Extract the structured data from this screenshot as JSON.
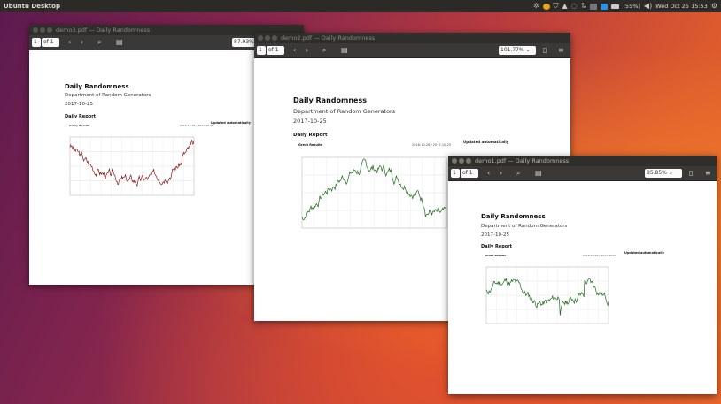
{
  "panel": {
    "title": "Ubuntu Desktop",
    "battery": "(55%)",
    "datetime": "Wed Oct 25 15:53"
  },
  "windows": [
    {
      "title": "demo3.pdf — Daily Randomness",
      "page_number": "1",
      "page_of": "of 1",
      "zoom": "87.93%",
      "doc": {
        "title": "Daily Randomness",
        "department": "Department of Random Generators",
        "date": "2017-10-25",
        "section": "Daily Report",
        "updated": "Updated automatically",
        "chart_name": "Grimy Results",
        "chart_range": "2016-10-26 / 2017-10-25",
        "line_color": "#8b1a1a"
      }
    },
    {
      "title": "demo2.pdf — Daily Randomness",
      "page_number": "1",
      "page_of": "of 1",
      "zoom": "101.77%",
      "doc": {
        "title": "Daily Randomness",
        "department": "Department of Random Generators",
        "date": "2017-10-25",
        "section": "Daily Report",
        "updated": "Updated automatically",
        "chart_name": "Great Results",
        "chart_range": "2016-10-26 / 2017-10-25",
        "line_color": "#1f6b1f"
      }
    },
    {
      "title": "demo1.pdf — Daily Randomness",
      "page_number": "1",
      "page_of": "of 1",
      "zoom": "85.85%",
      "doc": {
        "title": "Daily Randomness",
        "department": "Department of Random Generators",
        "date": "2017-10-25",
        "section": "Daily Report",
        "updated": "Updated automatically",
        "chart_name": "Great Results",
        "chart_range": "2016-10-26 / 2017-10-25",
        "line_color": "#1f6b1f"
      }
    }
  ],
  "colors": {
    "panel_bg": "#2b2a27",
    "titlebar_bg": "#2f2e2b",
    "toolbar_bg": "#3a3937"
  }
}
